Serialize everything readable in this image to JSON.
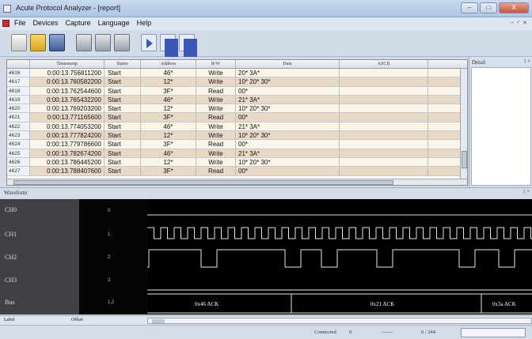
{
  "window": {
    "title": "Acute Protocol Analyzer - [report]",
    "min": "–",
    "max": "□",
    "close": "X"
  },
  "menu": {
    "items": [
      "File",
      "Devices",
      "Capture",
      "Language",
      "Help"
    ],
    "right": [
      "–",
      "♂",
      "✕"
    ]
  },
  "report": {
    "columns": [
      "",
      "Timestamp",
      "Status",
      "Address",
      "R/W",
      "Data",
      "ASCII",
      ""
    ],
    "rows": [
      [
        "4616",
        "0:00:13.756811200",
        "Start",
        "46*",
        "Write",
        "20* 3A*",
        "",
        ""
      ],
      [
        "4617",
        "0:00:13.760582200",
        "Start",
        "12*",
        "Write",
        "10* 20* 30*",
        "",
        ""
      ],
      [
        "4618",
        "0:00:13.762544600",
        "Start",
        "3F*",
        "Read",
        "00*",
        "",
        ""
      ],
      [
        "4619",
        "0:00:13.765432200",
        "Start",
        "46*",
        "Write",
        "21* 3A*",
        "",
        ""
      ],
      [
        "4620",
        "0:00:13.769203200",
        "Start",
        "12*",
        "Write",
        "10* 20* 30*",
        "",
        ""
      ],
      [
        "4621",
        "0:00:13.771165600",
        "Start",
        "3F*",
        "Read",
        "00*",
        "",
        ""
      ],
      [
        "4622",
        "0:00:13.774053200",
        "Start",
        "46*",
        "Write",
        "21* 3A*",
        "",
        ""
      ],
      [
        "4623",
        "0:00:13.777824200",
        "Start",
        "12*",
        "Write",
        "10* 20* 30*",
        "",
        ""
      ],
      [
        "4624",
        "0:00:13.779786600",
        "Start",
        "3F*",
        "Read",
        "00*",
        "",
        ""
      ],
      [
        "4625",
        "0:00:13.782674200",
        "Start",
        "46*",
        "Write",
        "21* 3A*",
        "",
        ""
      ],
      [
        "4626",
        "0:00:13.786445200",
        "Start",
        "12*",
        "Write",
        "10* 20* 30*",
        "",
        ""
      ],
      [
        "4627",
        "0:00:13.788407600",
        "Start",
        "3F*",
        "Read",
        "00*",
        "",
        ""
      ]
    ]
  },
  "detail": {
    "title": "Detail",
    "pin": "‡ ×"
  },
  "waveform": {
    "title": "Waveform",
    "pin": "‡ ×",
    "channels": [
      {
        "name": "CH0",
        "num": "0"
      },
      {
        "name": "CH1",
        "num": "1"
      },
      {
        "name": "CH2",
        "num": "2"
      },
      {
        "name": "CH3",
        "num": "3"
      },
      {
        "name": "Bus",
        "num": "1,2"
      }
    ],
    "bus_labels": [
      "0x46 ACK",
      "0x21 ACK",
      "0x3a ACK"
    ],
    "colors": {
      "trace": "#e6e6e6",
      "bus": "#ffffff",
      "background": "#000000"
    }
  },
  "bottom": {
    "label": "Label",
    "offset": "Offset"
  },
  "status": {
    "connected": "Connected",
    "value": "0",
    "separator": "------",
    "count": "6 / 244"
  }
}
